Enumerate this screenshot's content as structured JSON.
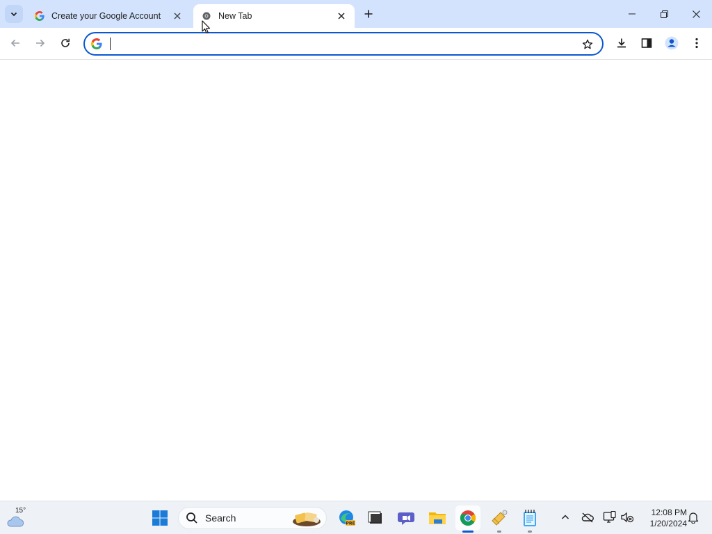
{
  "tabs": [
    {
      "title": "Create your Google Account",
      "favicon": "google-g-icon",
      "active": false
    },
    {
      "title": "New Tab",
      "favicon": "chrome-icon",
      "active": true
    }
  ],
  "omnibox": {
    "value": "",
    "placeholder": ""
  },
  "taskbar": {
    "weather_temp": "15°",
    "search_label": "Search",
    "apps": [
      "start-icon",
      "search-icon",
      "edge-preview-icon",
      "terminal-icon",
      "teams-icon",
      "file-explorer-icon",
      "chrome-icon",
      "pin-app-icon",
      "notepad-icon"
    ],
    "clock_time": "12:08 PM",
    "clock_date": "1/20/2024"
  },
  "colors": {
    "accent": "#0b57d0",
    "tabstrip": "#d3e3fd",
    "taskbar": "#eef1f6"
  }
}
